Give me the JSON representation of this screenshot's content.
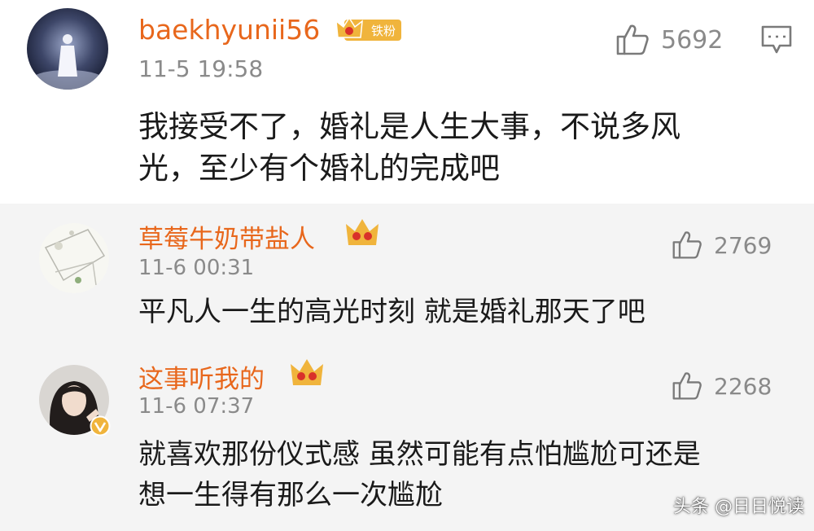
{
  "colors": {
    "username": "#e8671c",
    "timestamp": "#8a8a8a",
    "body_text": "#1a1a1a",
    "crown_badge": "#f0b43c",
    "verified_badge": "#f0b43c",
    "row_alt_background": "#f4f4f4"
  },
  "comments": [
    {
      "username": "baekhyunii56",
      "badge_icon": "crown-fan-icon",
      "badge_label": "铁粉",
      "timestamp": "11-5 19:58",
      "likes": "5692",
      "body_lines": [
        "我接受不了，婚礼是人生大事，不说多风",
        "光，至少有个婚礼的完成吧"
      ]
    },
    {
      "username": "草莓牛奶带盐人",
      "badge_icon": "crown-icon",
      "timestamp": "11-6 00:31",
      "likes": "2769",
      "body_lines": [
        "平凡人一生的高光时刻 就是婚礼那天了吧"
      ]
    },
    {
      "username": "这事听我的",
      "badge_icon": "crown-icon",
      "verified_icon": "verified-v-icon",
      "timestamp": "11-6 07:37",
      "likes": "2268",
      "body_lines": [
        "就喜欢那份仪式感 虽然可能有点怕尴尬可还是",
        "想一生得有那么一次尴尬"
      ]
    }
  ],
  "watermark": "头条 @日日悦读"
}
